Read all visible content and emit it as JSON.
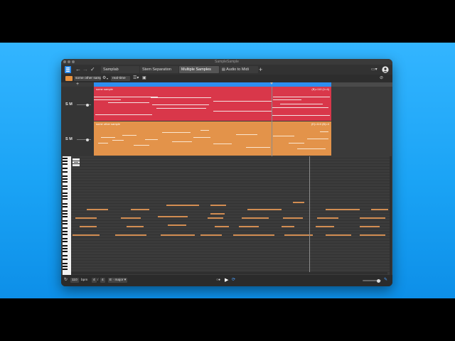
{
  "window": {
    "title": "SampleSample"
  },
  "toolbar": {
    "back_glyph": "←",
    "forward_glyph": "→",
    "check_glyph": "✓",
    "tabs": [
      {
        "label": "Samplab"
      },
      {
        "label": "Stem Separation"
      },
      {
        "label": "Multiple Samples"
      },
      {
        "label": "Audio to Midi"
      }
    ],
    "add_tab_glyph": "+",
    "window_glyph": "▭▾",
    "user_glyph": "●"
  },
  "controls": {
    "sample_select": "some other sample",
    "gear_glyph": "⚙",
    "mode_select": "real-time",
    "list_glyph": "☰▾",
    "save_glyph": "▣",
    "add_track_glyph": "+",
    "tool_glyph": "⊘"
  },
  "tracks": [
    {
      "sm_label": "S M",
      "clip_label": "some sample",
      "clip_info": "(B)=110 (1=4)",
      "color": "#d9374a",
      "volume": 0.75
    },
    {
      "sm_label": "S M",
      "clip_label": "some other sample",
      "clip_info": "(E)=110 (B)=4",
      "color": "#e3934a",
      "volume": 0.75
    }
  ],
  "bottom": {
    "loop_glyph": "↻",
    "tempo": "110",
    "bpm_label": "bpm",
    "time_sig_num": "4",
    "time_sig_sep": "/",
    "time_sig_den": "4",
    "key": "E",
    "scale": "major",
    "record_glyph": "○●",
    "play_glyph": "▶",
    "loop2_glyph": "⟳",
    "edit_glyph": "✎",
    "master_volume": 0.85
  },
  "colors": {
    "accent": "#2d8ef0",
    "note": "#d28d52",
    "background": "#1aa3f5"
  }
}
